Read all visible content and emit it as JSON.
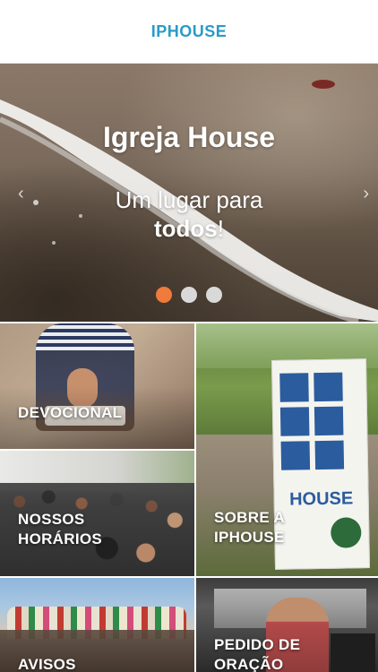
{
  "header": {
    "title": "IPHOUSE"
  },
  "hero": {
    "headline": "Igreja House",
    "tagline_regular": "Um lugar para",
    "tagline_bold": "todos",
    "tagline_suffix": "!",
    "prev_glyph": "‹",
    "next_glyph": "›",
    "slides_total": 3,
    "active_slide": 1,
    "dot_active_color": "#ee7a3b",
    "dot_inactive_color": "#d9d9d9"
  },
  "tiles": {
    "devocional": {
      "line1": "DEVOCIONAL"
    },
    "sobre": {
      "line1": "SOBRE A",
      "line2": "IPHOUSE"
    },
    "horarios": {
      "line1": "NOSSOS",
      "line2": "HORÁRIOS"
    },
    "avisos": {
      "line1": "AVISOS"
    },
    "oracao": {
      "line1": "PEDIDO DE",
      "line2": "ORAÇÃO"
    }
  },
  "banner": {
    "house_text": "HOUSE"
  },
  "colors": {
    "accent": "#2a9bc6"
  }
}
